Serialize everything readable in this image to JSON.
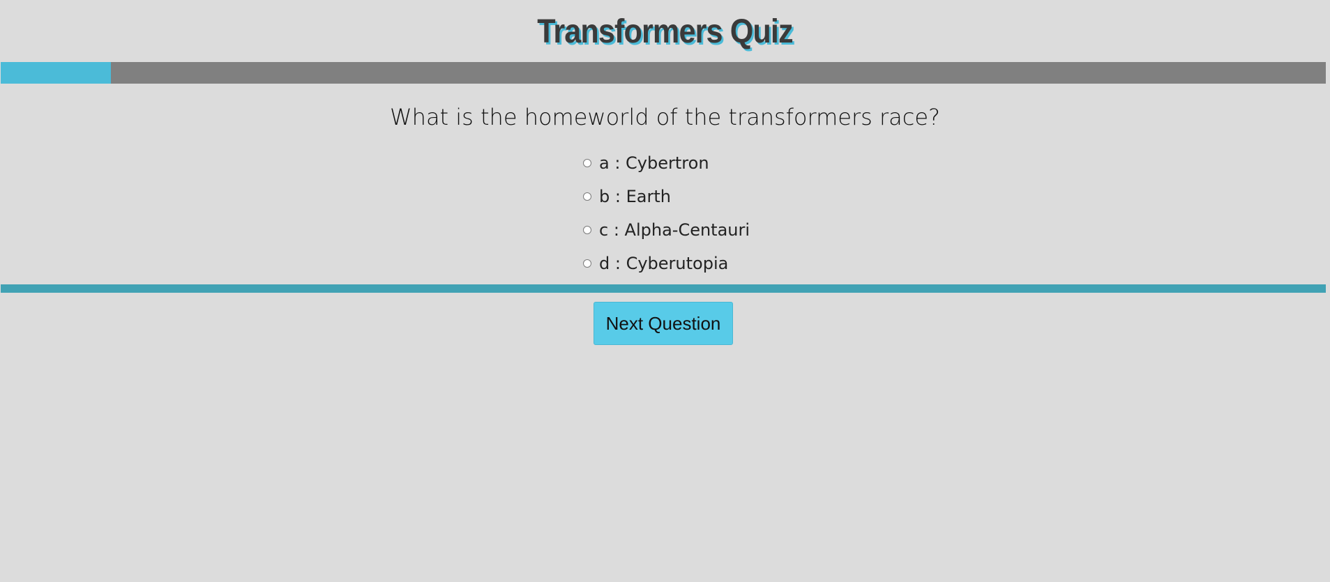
{
  "header": {
    "title": "Transformers Quiz"
  },
  "progress": {
    "fraction": 0.083,
    "fill_color": "#4bbbd8",
    "track_color": "#808080"
  },
  "question": {
    "text": "What is the homeworld of the transformers race?",
    "options": [
      {
        "label": "a : Cybertron"
      },
      {
        "label": "b : Earth"
      },
      {
        "label": "c : Alpha-Centauri"
      },
      {
        "label": "d : Cyberutopia"
      }
    ]
  },
  "actions": {
    "next_label": "Next Question"
  },
  "colors": {
    "background": "#dcdcdc",
    "accent": "#4bbbd8",
    "divider": "#41a2b4",
    "button": "#58cbe8"
  }
}
